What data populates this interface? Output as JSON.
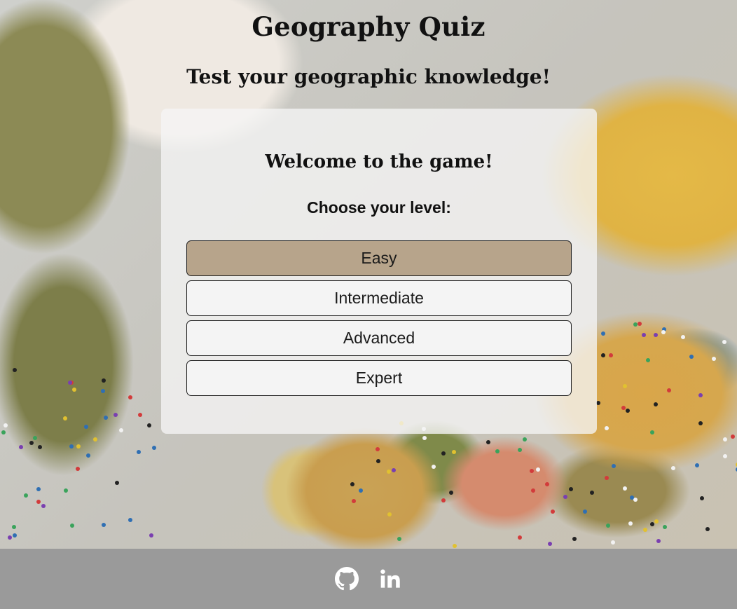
{
  "header": {
    "title": "Geography Quiz",
    "subtitle": "Test your geographic knowledge!"
  },
  "card": {
    "welcome": "Welcome to the game!",
    "prompt": "Choose your level:",
    "levels": [
      {
        "label": "Easy",
        "selected": true
      },
      {
        "label": "Intermediate",
        "selected": false
      },
      {
        "label": "Advanced",
        "selected": false
      },
      {
        "label": "Expert",
        "selected": false
      }
    ]
  },
  "footer": {
    "icons": [
      "github-icon",
      "linkedin-icon"
    ]
  },
  "colors": {
    "selected_button": "#b7a48b",
    "button": "#f4f4f4",
    "footer": "#9a9a9a",
    "card": "#f5f5f5"
  }
}
